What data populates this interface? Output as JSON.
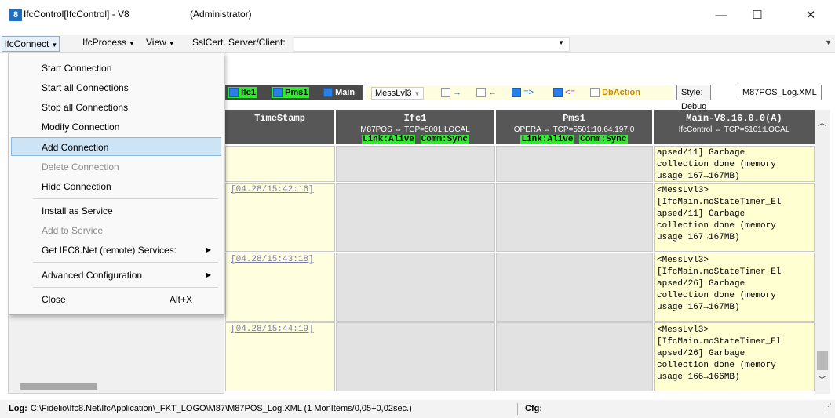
{
  "window": {
    "title": "IfcControl[IfcControl] - V8",
    "admin": "(Administrator)",
    "icon_label": "8",
    "minimize": "—",
    "maximize": "☐",
    "close": "✕"
  },
  "menubar": {
    "connect": "IfcConnect",
    "process": "IfcProcess",
    "view": "View",
    "ssl": "SslCert. Server/Client:",
    "ssl_value": ""
  },
  "dropdown": {
    "items": [
      {
        "label": "Start Connection"
      },
      {
        "label": "Start all Connections"
      },
      {
        "label": "Stop all Connections"
      },
      {
        "label": "Modify Connection"
      },
      {
        "label": "Add Connection"
      },
      {
        "label": "Delete Connection"
      },
      {
        "label": "Hide Connection"
      },
      {
        "label": "Install as Service"
      },
      {
        "label": "Add to Service"
      },
      {
        "label": "Get IFC8.Net (remote) Services:"
      },
      {
        "label": "Advanced Configuration"
      },
      {
        "label": "Close",
        "shortcut": "Alt+X"
      }
    ],
    "highlighted": "Add Connection",
    "disabled": [
      "Delete Connection",
      "Add to Service"
    ]
  },
  "toolbar": {
    "ifc1": "Ifc1",
    "pms1": "Pms1",
    "main": "Main",
    "messlvl": "MessLvl3",
    "arrow_right": "→",
    "arrow_left": "←",
    "arrow_both": "=>",
    "arrow_le": "<=",
    "dbaction": "DbAction",
    "style": "Style: Debug",
    "logfile": "M87POS_Log.XML"
  },
  "grid": {
    "columns": [
      {
        "title": "TimeStamp"
      },
      {
        "title": "Ifc1",
        "sub": "M87POS ⇔ TCP=5001:LOCAL",
        "link": "Link:Alive",
        "comm": "Comm:Sync"
      },
      {
        "title": "Pms1",
        "sub": "OPERA ⇔ TCP=5501:10.64.197.0",
        "link": "Link:Alive",
        "comm": "Comm:Sync"
      },
      {
        "title": "Main-V8.16.0.0(A)",
        "sub": "IfcControl ⇔ TCP=5101:LOCAL"
      }
    ],
    "rows": [
      {
        "ts": "",
        "msg": "apsed/11] Garbage\ncollection done (memory\nusage 167→167MB)"
      },
      {
        "ts": "[04.28/15:42:16]",
        "msg": "<MessLvl3>\n[IfcMain.moStateTimer_El\napsed/11] Garbage\ncollection done (memory\nusage 167→167MB)"
      },
      {
        "ts": "[04.28/15:43:18]",
        "msg": "<MessLvl3>\n[IfcMain.moStateTimer_El\napsed/26] Garbage\ncollection done (memory\nusage 167→167MB)"
      },
      {
        "ts": "[04.28/15:44:19]",
        "msg": "<MessLvl3>\n[IfcMain.moStateTimer_El\napsed/26] Garbage\ncollection done (memory\nusage 166→166MB)"
      }
    ]
  },
  "statusbar": {
    "log_label": "Log:",
    "log_value": "C:\\Fidelio\\Ifc8.Net\\IfcApplication\\_FKT_LOGO\\M87\\M87POS_Log.XML (1 MonItems/0,05+0,02sec.)",
    "cfg_label": "Cfg:"
  },
  "colors": {
    "accent_green": "#33e733",
    "header_grey": "#575757",
    "highlight_blue": "#cde4f7",
    "cell_yellow": "#ffffd2"
  }
}
